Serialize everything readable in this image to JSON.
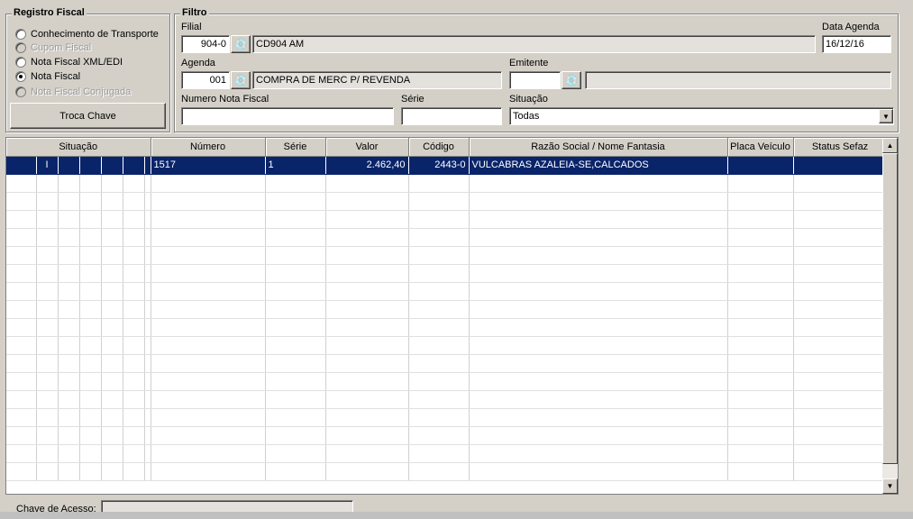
{
  "registro": {
    "title": "Registro Fiscal",
    "options": [
      {
        "label": "Conhecimento de Transporte",
        "checked": false,
        "disabled": false
      },
      {
        "label": "Cupom Fiscal",
        "checked": false,
        "disabled": true
      },
      {
        "label": "Nota Fiscal XML/EDI",
        "checked": false,
        "disabled": false
      },
      {
        "label": "Nota Fiscal",
        "checked": true,
        "disabled": false
      },
      {
        "label": "Nota Fiscal Conjugada",
        "checked": false,
        "disabled": true
      }
    ],
    "troca_chave": "Troca Chave"
  },
  "filtro": {
    "title": "Filtro",
    "filial_label": "Filial",
    "filial_code": "904-0",
    "filial_name": "CD904                                    AM",
    "data_agenda_label": "Data Agenda",
    "data_agenda": "16/12/16",
    "agenda_label": "Agenda",
    "agenda_code": "001",
    "agenda_desc": "COMPRA DE MERC P/ REVENDA",
    "emitente_label": "Emitente",
    "emitente_code": "",
    "emitente_name": "",
    "numero_label": "Numero Nota Fiscal",
    "numero_value": "",
    "serie_label": "Série",
    "serie_value": "",
    "situacao_label": "Situação",
    "situacao_value": "Todas",
    "search_icon": "binoculars-icon"
  },
  "grid": {
    "columns": [
      "Situação",
      "Número",
      "Série",
      "Valor",
      "Código",
      "Razão Social / Nome Fantasia",
      "Placa Veículo",
      "Status Sefaz"
    ],
    "rows": [
      {
        "sit": [
          "",
          "I",
          "",
          "",
          "",
          "",
          ""
        ],
        "numero": "1517",
        "serie": "1",
        "valor": "2.462,40",
        "codigo": "2443-0",
        "razao": "VULCABRAS AZALEIA-SE,CALCADOS",
        "placa": "",
        "status": ""
      }
    ]
  },
  "footer": {
    "chave_label": "Chave de Acesso:",
    "chave_value": ""
  },
  "colors": {
    "selection": "#0a246a",
    "face": "#d4d0c8"
  }
}
